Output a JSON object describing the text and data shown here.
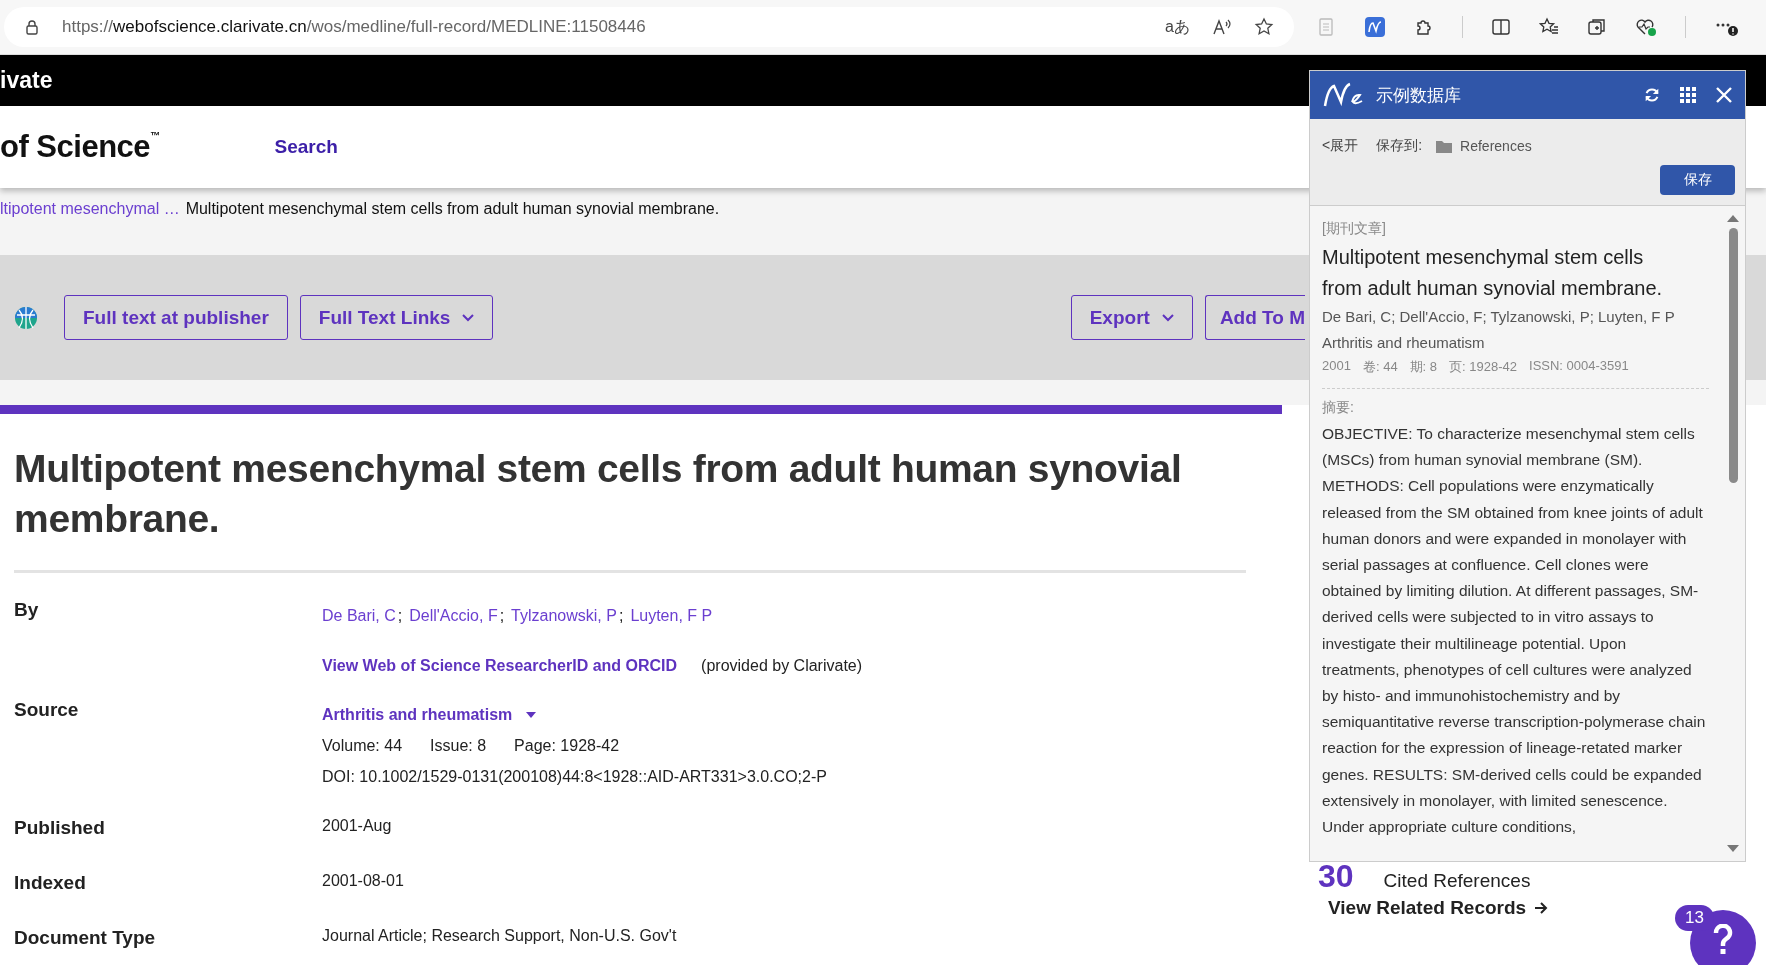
{
  "browser": {
    "url": {
      "scheme": "https://",
      "host": "webofscience.clarivate.cn",
      "path": "/wos/medline/full-record/MEDLINE:11508446"
    },
    "translate": "aあ"
  },
  "header": {
    "brand": "ivate"
  },
  "nav": {
    "logo": "of Science",
    "logo_mark": "™",
    "links": [
      {
        "label": "Search"
      }
    ]
  },
  "breadcrumb": {
    "parent": "ltipotent mesenchymal …",
    "current": "Multipotent mesenchymal stem cells from adult human synovial membrane."
  },
  "toolbar": {
    "left": [
      {
        "label": "Full text at publisher",
        "dropdown": false
      },
      {
        "label": "Full Text Links",
        "dropdown": true
      }
    ],
    "right": [
      {
        "label": "Export",
        "dropdown": true
      },
      {
        "label": "Add To M",
        "dropdown": false
      }
    ]
  },
  "record": {
    "title": "Multipotent mesenchymal stem cells from adult human synovial membrane.",
    "fields": [
      {
        "kind": "authors",
        "label": "By",
        "authors": [
          "De Bari, C",
          "Dell'Accio, F",
          "Tylzanowski, P",
          "Luyten, F P"
        ],
        "separator": ";",
        "link": "View Web of Science ResearcherID and ORCID",
        "note": "(provided by Clarivate)"
      },
      {
        "kind": "source",
        "label": "Source",
        "journal": "Arthritis and rheumatism",
        "details": [
          "Volume: 44",
          "Issue: 8",
          "Page: 1928-42"
        ],
        "doi": "DOI: 10.1002/1529-0131(200108)44:8<1928::AID-ART331>3.0.CO;2-P"
      },
      {
        "kind": "text",
        "label": "Published",
        "value": "2001-Aug"
      },
      {
        "kind": "text",
        "label": "Indexed",
        "value": "2001-08-01"
      },
      {
        "kind": "text",
        "label": "Document Type",
        "value": "Journal Article; Research Support, Non-U.S. Gov't"
      }
    ]
  },
  "sidebar": {
    "count": "30",
    "label": "Cited References",
    "link": "View Related Records"
  },
  "help": {
    "count": "13"
  },
  "extension": {
    "title": "示例数据库",
    "expand": "<展开",
    "save_to": "保存到:",
    "folder": "References",
    "save": "保存",
    "type": "[期刊文章]",
    "item_title": "Multipotent mesenchymal stem cells from adult human synovial membrane.",
    "authors": "De Bari, C; Dell'Accio, F; Tylzanowski, P; Luyten, F P",
    "journal": "Arthritis and rheumatism",
    "meta": [
      "2001",
      "卷: 44",
      "期: 8",
      "页: 1928-42",
      "ISSN: 0004-3591"
    ],
    "abstract_label": "摘要:",
    "abstract": "OBJECTIVE: To characterize mesenchymal stem cells (MSCs) from human synovial membrane (SM). METHODS: Cell populations were enzymatically released from the SM obtained from knee joints of adult human donors and were expanded in monolayer with serial passages at confluence. Cell clones were obtained by limiting dilution. At different passages, SM-derived cells were subjected to in vitro assays to investigate their multilineage potential. Upon treatments, phenotypes of cell cultures were analyzed by histo- and immunohistochemistry and by semiquantitative reverse transcription-polymerase chain reaction for the expression of lineage-retated marker genes. RESULTS: SM-derived cells could be expanded extensively in monolayer, with limited senescence. Under appropriate culture conditions,"
  }
}
